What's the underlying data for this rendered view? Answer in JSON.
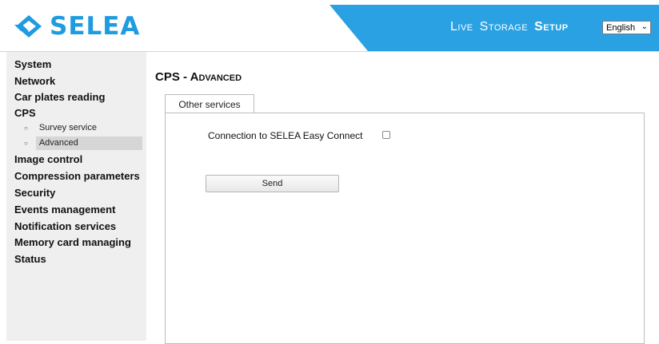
{
  "brand": {
    "name": "SELEA",
    "color": "#1f9be0",
    "banner_color": "#2aa1e2"
  },
  "top_nav": {
    "live_label": "Live",
    "storage_label": "Storage",
    "setup_label": "Setup",
    "active": "Setup"
  },
  "language": {
    "selected": "English"
  },
  "sidebar": {
    "items": [
      {
        "label": "System"
      },
      {
        "label": "Network"
      },
      {
        "label": "Car plates reading"
      },
      {
        "label": "CPS"
      },
      {
        "label": "Image control"
      },
      {
        "label": "Compression parameters"
      },
      {
        "label": "Security"
      },
      {
        "label": "Events management"
      },
      {
        "label": "Notification services"
      },
      {
        "label": "Memory card managing"
      },
      {
        "label": "Status"
      }
    ],
    "cps_subitems": [
      {
        "label": "Survey service"
      },
      {
        "label": "Advanced"
      }
    ],
    "active_subitem": "Advanced"
  },
  "main": {
    "title": "CPS - Advanced",
    "tab_label": "Other services",
    "connection_label": "Connection to SELEA Easy Connect",
    "connection_checked": false,
    "send_label": "Send"
  }
}
